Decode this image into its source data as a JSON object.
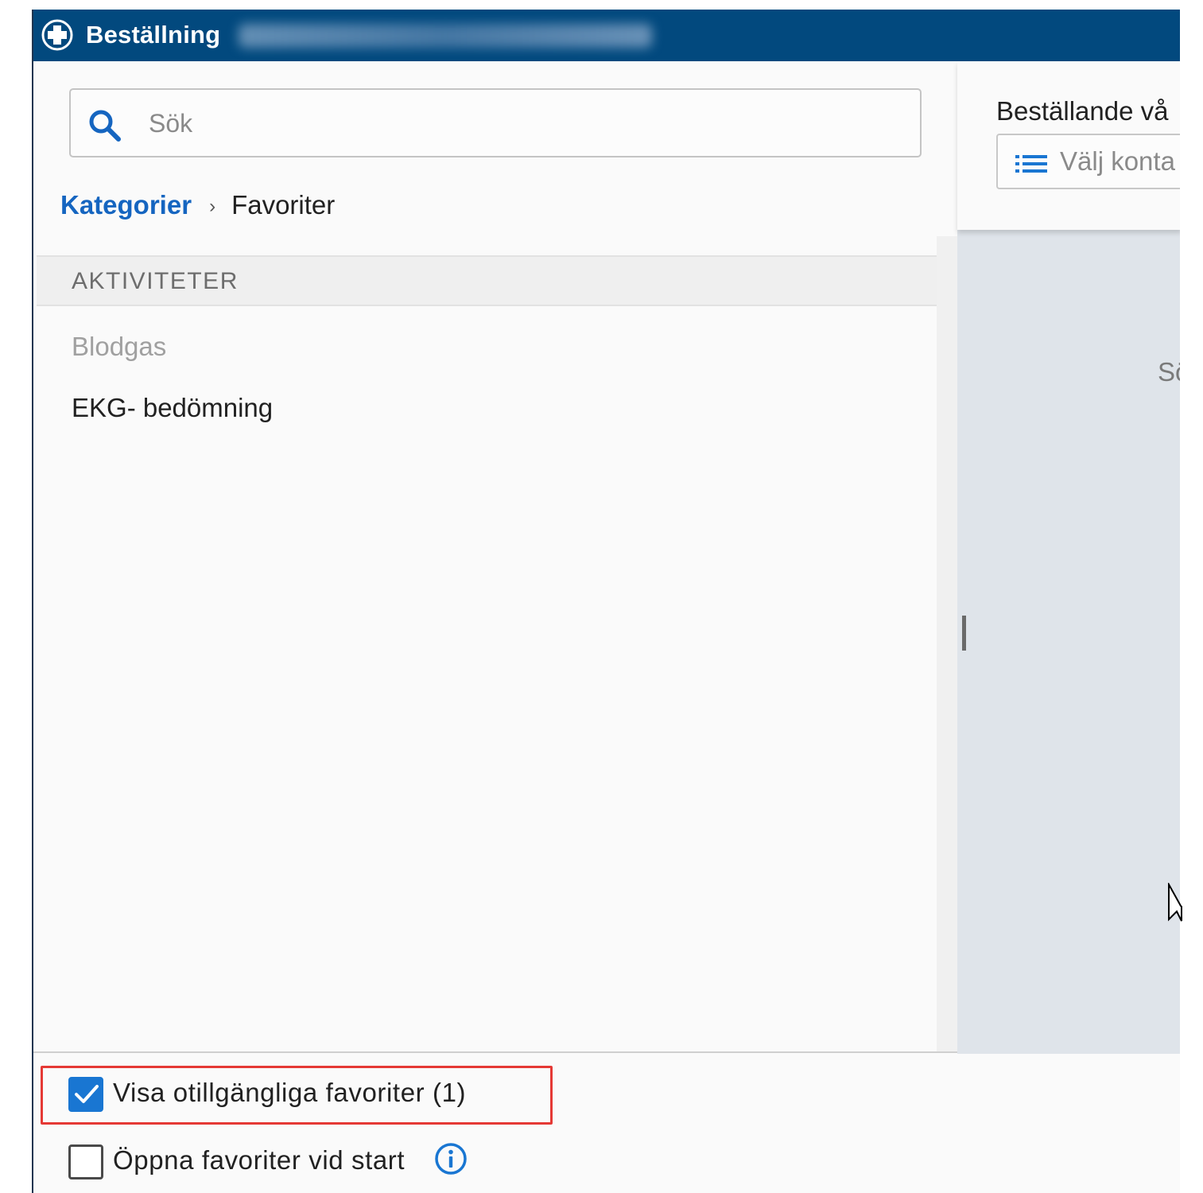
{
  "titlebar": {
    "title": "Beställning"
  },
  "left_panel": {
    "search": {
      "placeholder": "Sök",
      "value": ""
    },
    "breadcrumb": {
      "parent": "Kategorier",
      "separator": "›",
      "current": "Favoriter"
    },
    "section": {
      "header": "AKTIVITETER",
      "items": [
        {
          "label": "Blodgas",
          "available": false
        },
        {
          "label": "EKG- bedömning",
          "available": true
        }
      ]
    },
    "footer": {
      "show_unavailable": {
        "label": "Visa otillgängliga favoriter (1)",
        "checked": true
      },
      "open_on_start": {
        "label": "Öppna favoriter vid start",
        "checked": false
      }
    }
  },
  "right_panel": {
    "ordering_unit_label": "Beställande vå",
    "contact_select_placeholder": "Välj konta",
    "body_text": "Sö"
  },
  "colors": {
    "titlebar": "#02497e",
    "accent": "#1976d2",
    "link": "#1565c0",
    "highlight": "#e53935",
    "right_body": "#dfe4ea"
  },
  "icons": {
    "app_logo": "medical-cross-icon",
    "search": "search-icon",
    "list": "list-icon",
    "info": "info-icon",
    "check": "checkmark-icon",
    "cursor": "mouse-pointer-icon"
  }
}
